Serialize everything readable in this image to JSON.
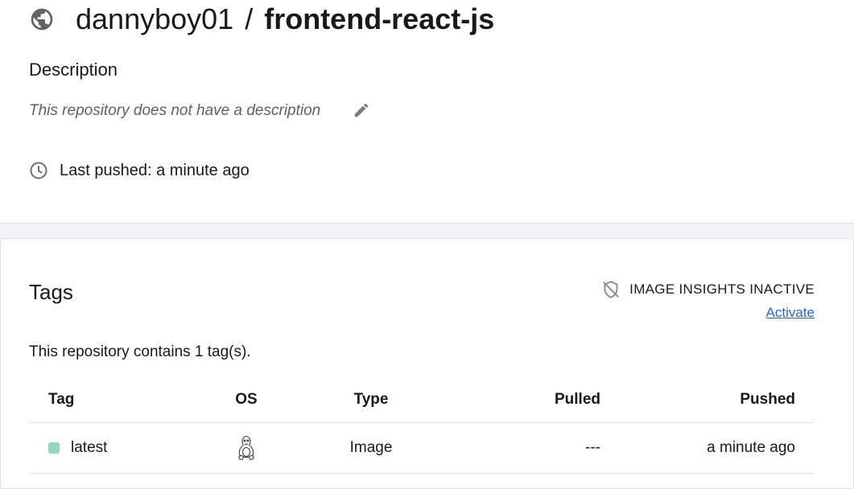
{
  "repo": {
    "owner": "dannyboy01",
    "separator": "/",
    "name": "frontend-react-js",
    "visibility_icon": "globe-icon"
  },
  "description": {
    "heading": "Description",
    "text": "This repository does not have a description",
    "edit_icon": "pencil-icon"
  },
  "last_pushed": {
    "text": "Last pushed: a minute ago",
    "icon": "clock-icon"
  },
  "tags": {
    "heading": "Tags",
    "insights_label": "IMAGE INSIGHTS INACTIVE",
    "insights_icon": "shield-off-icon",
    "activate_label": "Activate",
    "count_text": "This repository contains 1 tag(s).",
    "columns": [
      "Tag",
      "OS",
      "Type",
      "Pulled",
      "Pushed"
    ],
    "rows": [
      {
        "tag": "latest",
        "os": "linux-icon",
        "type": "Image",
        "pulled": "---",
        "pushed": "a minute ago"
      }
    ]
  },
  "colors": {
    "accent_link": "#1d63ed",
    "tag_dot": "#8fd8bc",
    "page_bg": "#f4f4f6"
  }
}
